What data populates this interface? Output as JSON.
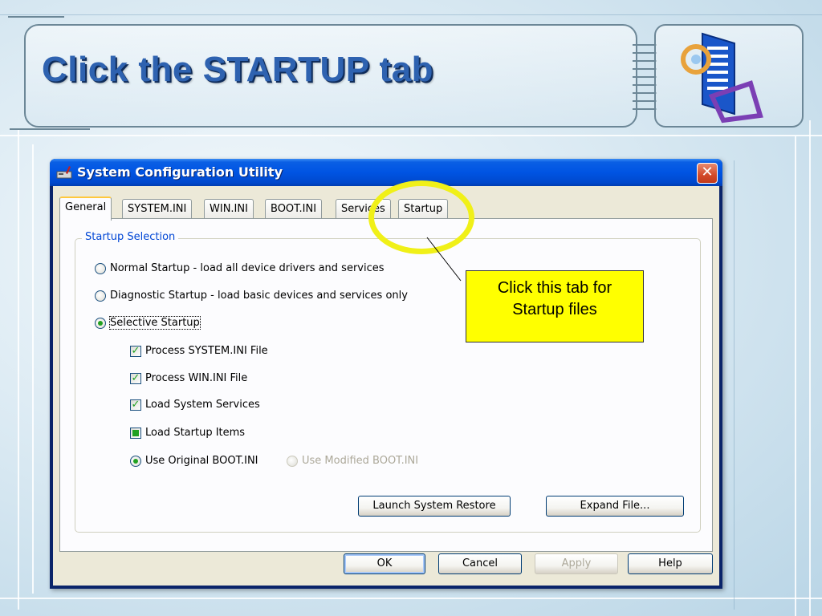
{
  "slide": {
    "title": "Click the STARTUP tab"
  },
  "window": {
    "title": "System Configuration Utility",
    "close_label": "✕"
  },
  "tabs": [
    {
      "label": "General"
    },
    {
      "label": "SYSTEM.INI"
    },
    {
      "label": "WIN.INI"
    },
    {
      "label": "BOOT.INI"
    },
    {
      "label": "Services"
    },
    {
      "label": "Startup"
    }
  ],
  "active_tab": "General",
  "startup_selection": {
    "legend": "Startup Selection",
    "options": [
      {
        "label": "Normal Startup - load all device drivers and services",
        "selected": false
      },
      {
        "label": "Diagnostic Startup - load basic devices and services only",
        "selected": false
      },
      {
        "label": "Selective Startup",
        "selected": true
      }
    ],
    "checkboxes": [
      {
        "label": "Process SYSTEM.INI File",
        "state": "checked"
      },
      {
        "label": "Process WIN.INI File",
        "state": "checked"
      },
      {
        "label": "Load System Services",
        "state": "checked"
      },
      {
        "label": "Load Startup Items",
        "state": "indeterminate"
      }
    ],
    "boot_options": [
      {
        "label": "Use Original BOOT.INI",
        "selected": true,
        "enabled": true
      },
      {
        "label": "Use Modified BOOT.INI",
        "selected": false,
        "enabled": false
      }
    ],
    "launch_restore_label": "Launch System Restore",
    "expand_file_label": "Expand File..."
  },
  "footer_buttons": {
    "ok": "OK",
    "cancel": "Cancel",
    "apply": "Apply",
    "help": "Help"
  },
  "callout": {
    "line1": "Click this tab for",
    "line2": "Startup files"
  },
  "colors": {
    "title_text": "#2e62b0",
    "titlebar": "#0054e3",
    "callout_bg": "#ffff00",
    "highlight_ring": "#f0f018",
    "group_legend": "#0046d5"
  }
}
